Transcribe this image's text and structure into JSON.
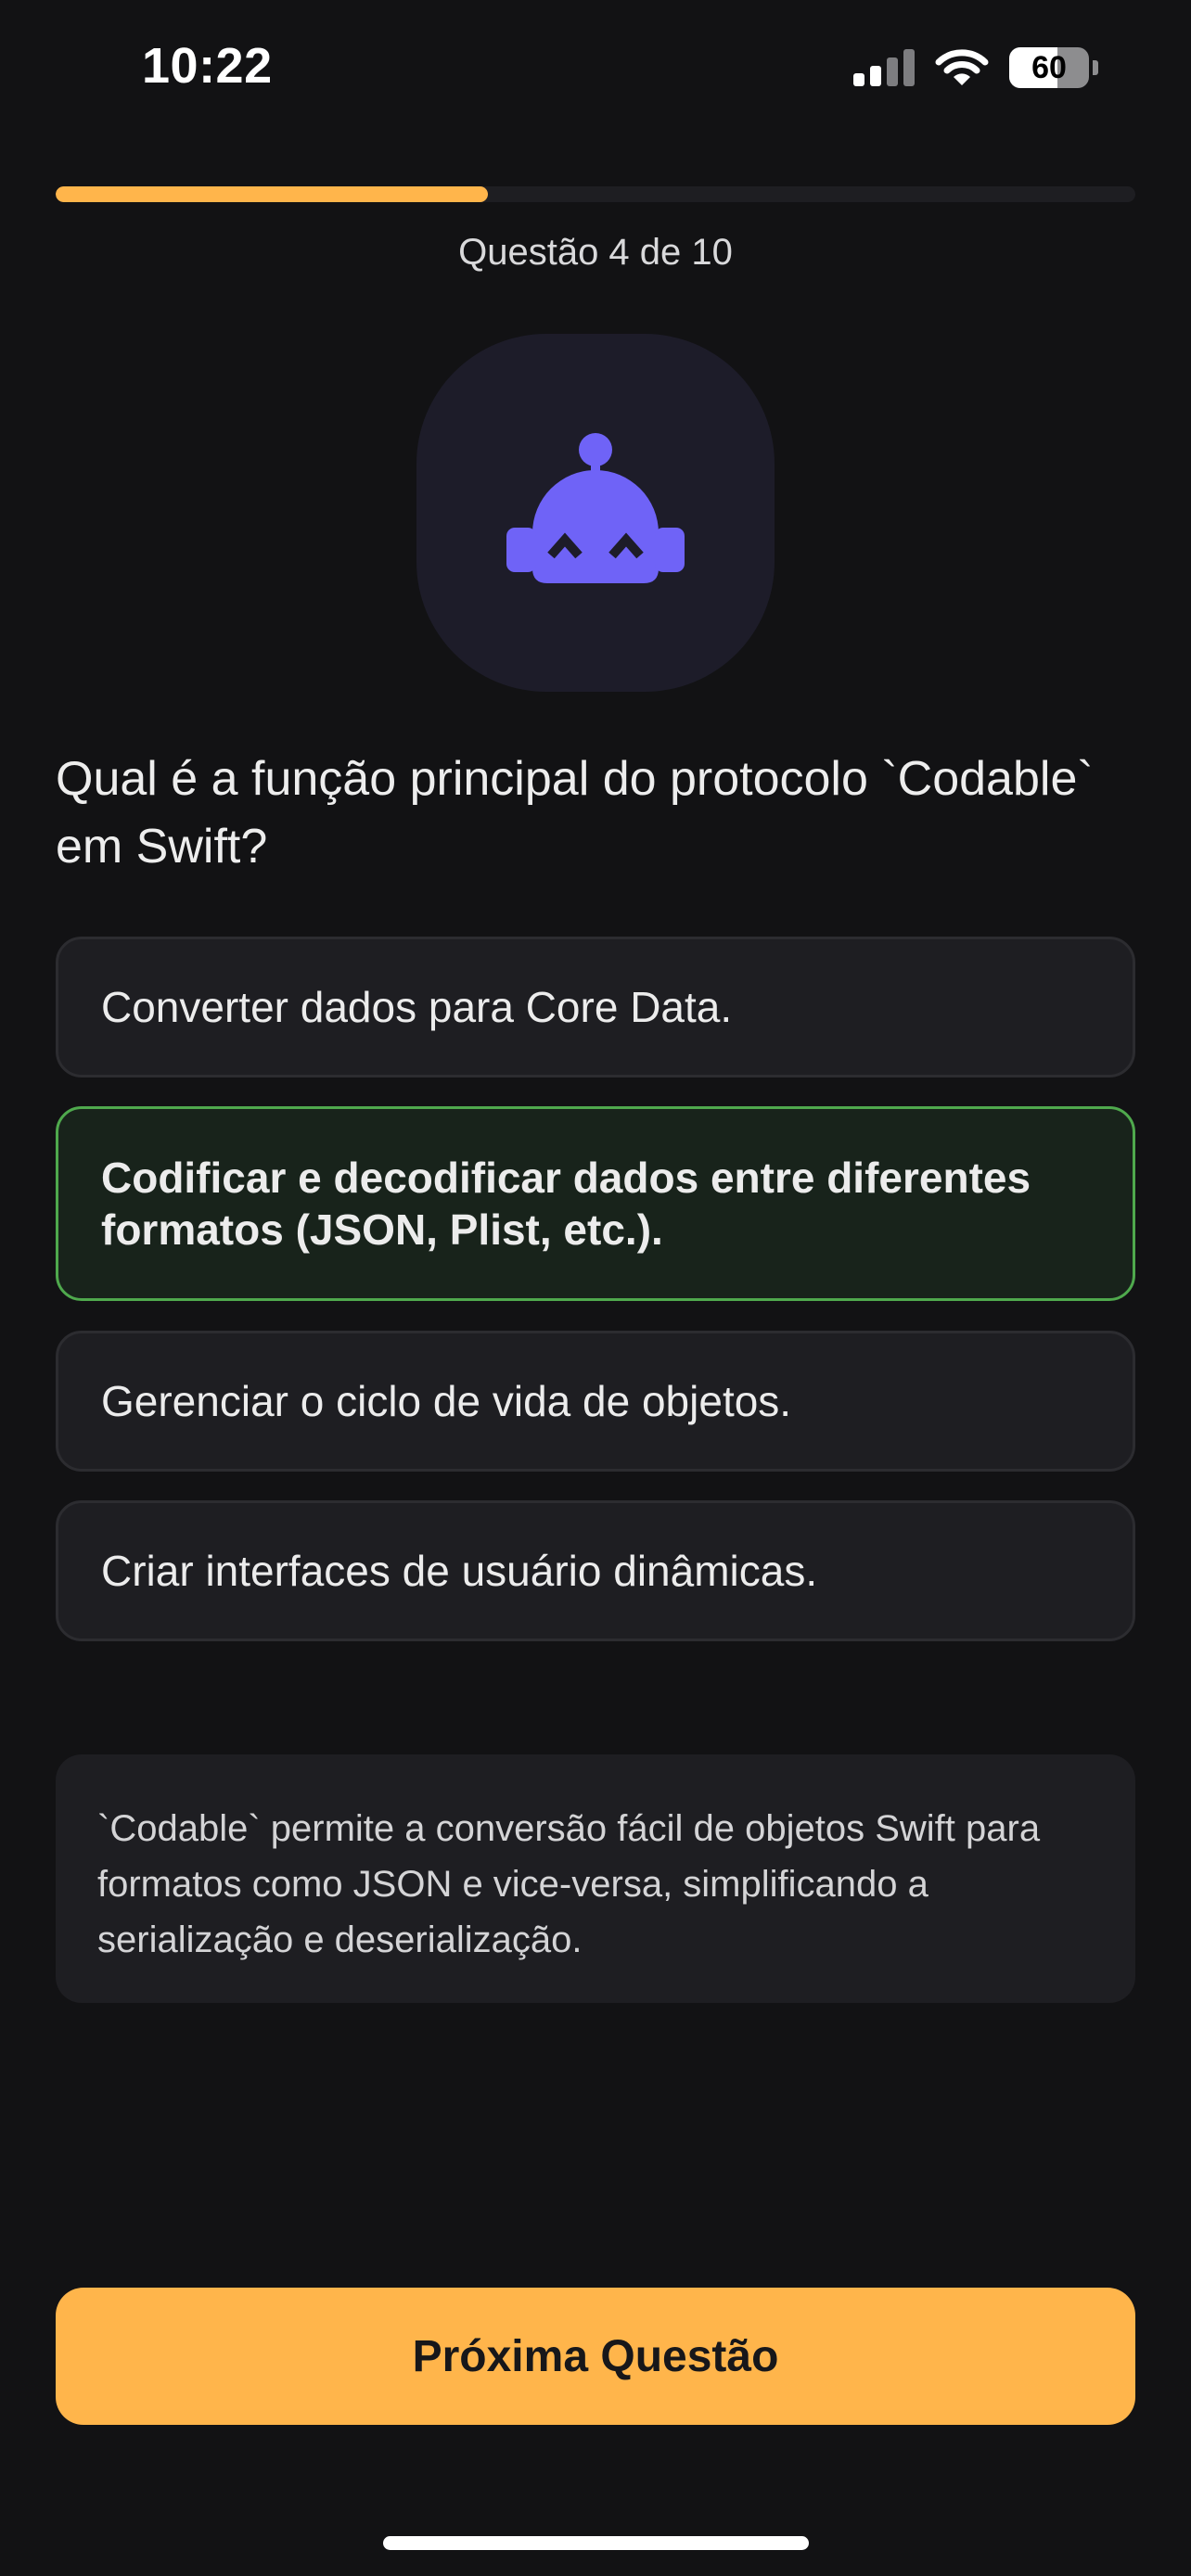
{
  "status_bar": {
    "time": "10:22",
    "battery_level": "60",
    "battery_fraction": 0.6,
    "icons": [
      "cellular-signal-icon",
      "wifi-icon",
      "battery-icon"
    ]
  },
  "progress": {
    "label": "Questão 4 de 10",
    "fraction": 0.4
  },
  "mascot": {
    "icon": "robot-icon",
    "color": "#6f63f7"
  },
  "quiz": {
    "question": "Qual é a função principal do protocolo `Codable` em Swift?",
    "options": [
      {
        "label": "Converter dados para Core Data.",
        "state": "default"
      },
      {
        "label": "Codificar e decodificar dados entre diferentes formatos (JSON, Plist, etc.).",
        "state": "correct"
      },
      {
        "label": "Gerenciar o ciclo de vida de objetos.",
        "state": "default"
      },
      {
        "label": "Criar interfaces de usuário dinâmicas.",
        "state": "default"
      }
    ],
    "explanation": "`Codable` permite a conversão fácil de objetos Swift para formatos como JSON e vice-versa, simplificando a serialização e deserialização."
  },
  "actions": {
    "next_label": "Próxima Questão"
  },
  "colors": {
    "background": "#121214",
    "accent": "#ffb54b",
    "correct_border": "#4fa94d",
    "card": "#1e1e22"
  }
}
